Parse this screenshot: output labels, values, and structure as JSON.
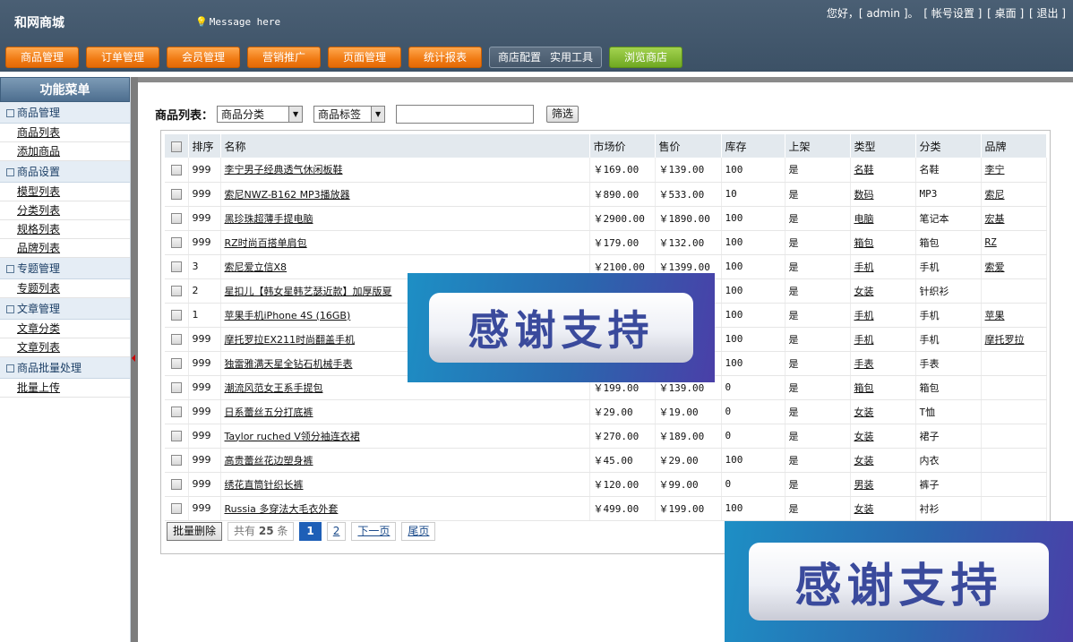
{
  "header": {
    "brand": "和网商城",
    "message": "Message here",
    "greeting": "您好，[ admin ]。",
    "account_settings": "[ 帐号设置 ]",
    "desktop": "[ 桌面 ]",
    "logout": "[ 退出 ]"
  },
  "nav": {
    "items": [
      "商品管理",
      "订单管理",
      "会员管理",
      "营销推广",
      "页面管理",
      "统计报表"
    ],
    "store_config": "商店配置",
    "tools": "实用工具",
    "browse": "浏览商店"
  },
  "sidebar": {
    "title": "功能菜单",
    "groups": [
      {
        "label": "商品管理",
        "items": [
          "商品列表",
          "添加商品"
        ]
      },
      {
        "label": "商品设置",
        "items": [
          "模型列表",
          "分类列表",
          "规格列表",
          "品牌列表"
        ]
      },
      {
        "label": "专题管理",
        "items": [
          "专题列表"
        ]
      },
      {
        "label": "文章管理",
        "items": [
          "文章分类",
          "文章列表"
        ]
      },
      {
        "label": "商品批量处理",
        "items": [
          "批量上传"
        ]
      }
    ]
  },
  "filter": {
    "label": "商品列表：",
    "category": "商品分类",
    "tag": "商品标签",
    "keyword": "",
    "button": "筛选"
  },
  "table": {
    "headers": [
      "排序",
      "名称",
      "市场价",
      "售价",
      "库存",
      "上架",
      "类型",
      "分类",
      "品牌"
    ],
    "rows": [
      [
        "999",
        "李宁男子经典透气休闲板鞋",
        "￥169.00",
        "￥139.00",
        "100",
        "是",
        "名鞋",
        "名鞋",
        "李宁"
      ],
      [
        "999",
        "索尼NWZ-B162 MP3播放器",
        "￥890.00",
        "￥533.00",
        "10",
        "是",
        "数码",
        "MP3",
        "索尼"
      ],
      [
        "999",
        "黑珍珠超薄手提电脑",
        "￥2900.00",
        "￥1890.00",
        "100",
        "是",
        "电脑",
        "笔记本",
        "宏基"
      ],
      [
        "999",
        "RZ时尚百搭单肩包",
        "￥179.00",
        "￥132.00",
        "100",
        "是",
        "箱包",
        "箱包",
        "RZ"
      ],
      [
        "3",
        "索尼爱立信X8",
        "￥2100.00",
        "￥1399.00",
        "100",
        "是",
        "手机",
        "手机",
        "索爱"
      ],
      [
        "2",
        "星扣儿【韩女星韩艺瑟近款】加厚版夏",
        "",
        "",
        "100",
        "是",
        "女装",
        "针织衫",
        ""
      ],
      [
        "1",
        "苹果手机iPhone 4S (16GB)",
        "",
        "",
        "100",
        "是",
        "手机",
        "手机",
        "苹果"
      ],
      [
        "999",
        "摩托罗拉EX211时尚翻盖手机",
        "",
        "",
        "100",
        "是",
        "手机",
        "手机",
        "摩托罗拉"
      ],
      [
        "999",
        "独雷雅满天星全钻石机械手表",
        "",
        "",
        "100",
        "是",
        "手表",
        "手表",
        ""
      ],
      [
        "999",
        "潮流风范女王系手提包",
        "￥199.00",
        "￥139.00",
        "0",
        "是",
        "箱包",
        "箱包",
        ""
      ],
      [
        "999",
        "日系蕾丝五分打底裤",
        "￥29.00",
        "￥19.00",
        "0",
        "是",
        "女装",
        "T恤",
        ""
      ],
      [
        "999",
        "Taylor ruched V领分袖连衣裙",
        "￥270.00",
        "￥189.00",
        "0",
        "是",
        "女装",
        "裙子",
        ""
      ],
      [
        "999",
        "高贵蕾丝花边塑身裤",
        "￥45.00",
        "￥29.00",
        "100",
        "是",
        "女装",
        "内衣",
        ""
      ],
      [
        "999",
        "绣花直筒针织长裤",
        "￥120.00",
        "￥99.00",
        "0",
        "是",
        "男装",
        "裤子",
        ""
      ],
      [
        "999",
        "Russia 多穿法大毛衣外套",
        "￥499.00",
        "￥199.00",
        "100",
        "是",
        "女装",
        "衬衫",
        ""
      ]
    ]
  },
  "pager": {
    "batch_delete": "批量删除",
    "total_prefix": "共有",
    "total": "25",
    "total_suffix": "条",
    "current": "1",
    "page2": "2",
    "next": "下一页",
    "last": "尾页"
  },
  "overlay": {
    "text": "感谢支持"
  }
}
